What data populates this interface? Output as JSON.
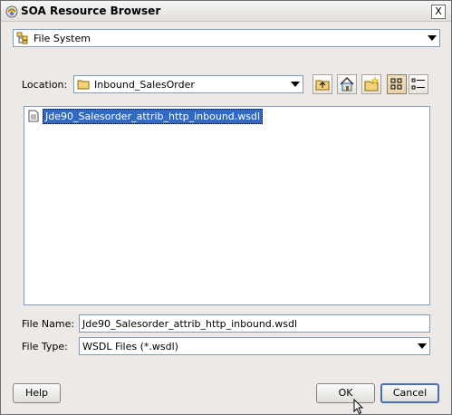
{
  "window": {
    "title": "SOA Resource Browser",
    "close_label": "X"
  },
  "source_combo": {
    "value": "File System",
    "icon": "tree-icon"
  },
  "location": {
    "label": "Location:",
    "value": "Inbound_SalesOrder",
    "icon": "folder-icon"
  },
  "toolbar": {
    "buttons": [
      "up-folder-icon",
      "home-icon",
      "new-folder-icon",
      "list-view-icon",
      "details-view-icon"
    ]
  },
  "files": [
    {
      "name": "Jde90_Salesorder_attrib_http_inbound.wsdl",
      "selected": true,
      "icon": "file-icon"
    }
  ],
  "file_name": {
    "label": "File Name:",
    "value": "Jde90_Salesorder_attrib_http_inbound.wsdl"
  },
  "file_type": {
    "label": "File Type:",
    "value": "WSDL Files (*.wsdl)"
  },
  "buttons": {
    "help": "Help",
    "ok": "OK",
    "cancel": "Cancel"
  },
  "colors": {
    "selection": "#316ac5",
    "window_bg": "#ece9e6"
  }
}
